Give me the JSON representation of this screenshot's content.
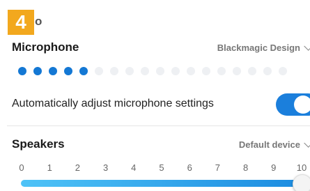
{
  "step": {
    "number": "4",
    "tail_text": "o"
  },
  "microphone": {
    "title": "Microphone",
    "device": "Blackmagic Design",
    "level_meter": {
      "active_dots": 5,
      "total_dots": 18
    },
    "auto_adjust_label": "Automatically adjust microphone settings",
    "auto_adjust_enabled": true
  },
  "speakers": {
    "title": "Speakers",
    "device": "Default device",
    "volume_scale": [
      "0",
      "1",
      "2",
      "3",
      "4",
      "5",
      "6",
      "7",
      "8",
      "9",
      "10"
    ],
    "volume_value": 10
  },
  "colors": {
    "accent": "#1b7fdc",
    "badge": "#f2a81e",
    "dot_active": "#1478d4",
    "dot_inactive": "#eef0f3"
  }
}
